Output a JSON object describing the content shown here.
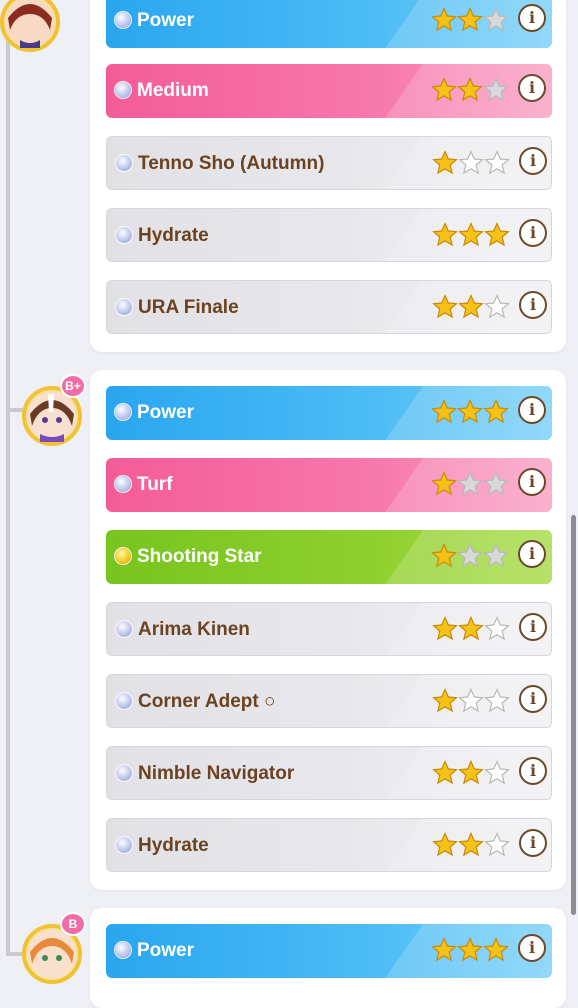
{
  "colors": {
    "blue": "#2aa6ef",
    "pink": "#f45c98",
    "green": "#78c420",
    "grey": "#e2e2e6",
    "label_brown": "#6b4320",
    "star_gold": "#f6c21a",
    "star_empty": "#cccccc"
  },
  "groups": [
    {
      "rank_badge": "",
      "factors": [
        {
          "name": "Power",
          "type": "blue",
          "stars": 2
        },
        {
          "name": "Medium",
          "type": "pink",
          "stars": 2
        },
        {
          "name": "Tenno Sho (Autumn)",
          "type": "grey",
          "stars": 1
        },
        {
          "name": "Hydrate",
          "type": "grey",
          "stars": 3
        },
        {
          "name": "URA Finale",
          "type": "grey",
          "stars": 2
        }
      ]
    },
    {
      "rank_badge": "B+",
      "factors": [
        {
          "name": "Power",
          "type": "blue",
          "stars": 3
        },
        {
          "name": "Turf",
          "type": "pink",
          "stars": 1
        },
        {
          "name": "Shooting Star",
          "type": "green",
          "stars": 1
        },
        {
          "name": "Arima Kinen",
          "type": "grey",
          "stars": 2
        },
        {
          "name": "Corner Adept ○",
          "type": "grey",
          "stars": 1
        },
        {
          "name": "Nimble Navigator",
          "type": "grey",
          "stars": 2
        },
        {
          "name": "Hydrate",
          "type": "grey",
          "stars": 2
        }
      ]
    },
    {
      "rank_badge": "B",
      "factors": [
        {
          "name": "Power",
          "type": "blue",
          "stars": 3
        }
      ]
    }
  ],
  "icons": {
    "info": "info-icon",
    "star": "star-icon",
    "dot": "factor-dot-icon",
    "info_glyph": "i"
  }
}
